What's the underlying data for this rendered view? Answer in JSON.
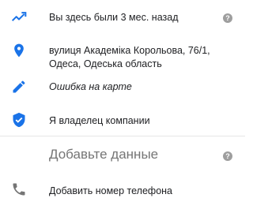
{
  "accent_color": "#1a73e8",
  "rows": [
    {
      "icon": "trending-icon",
      "label": "Вы здесь были 3 мес. назад"
    },
    {
      "icon": "location-pin-icon",
      "line1": "вулиця Академіка Корольова, 76/1,",
      "line2": "Одеса, Одеська область"
    },
    {
      "icon": "pencil-icon",
      "label": "Ошибка на карте"
    },
    {
      "icon": "verified-shield-icon",
      "label": "Я владелец компании"
    }
  ],
  "section": {
    "title": "Добавьте данные"
  },
  "add_phone": {
    "icon": "phone-icon",
    "label": "Добавить номер телефона"
  },
  "help_glyph": "?"
}
